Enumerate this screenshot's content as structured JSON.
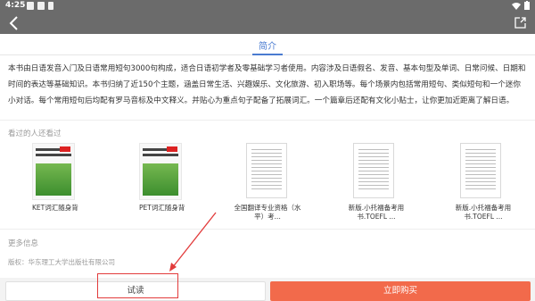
{
  "status": {
    "time": "4:25"
  },
  "tab": {
    "label": "简介"
  },
  "intro": {
    "text": "本书由日语发音入门及日语常用短句3000句构成，适合日语初学者及零基础学习者使用。内容涉及日语假名、发音、基本句型及单词、日常问候、日期和时间的表达等基础知识。本书归纳了近150个主题，涵盖日常生活、兴趣娱乐、文化旅游、初入职场等。每个场景内包括常用短句、类似短句和一个迷你小对话。每个常用短句后均配有罗马音标及中文释义。并贴心为重点句子配备了拓展词汇。一个篇章后还配有文化小贴士，让你更加近距离了解日语。"
  },
  "seen_section": {
    "title": "看过的人还看过"
  },
  "books": [
    {
      "title": "KET词汇随身背"
    },
    {
      "title": "PET词汇随身背"
    },
    {
      "title": "全国翻译专业资格（水平）考..."
    },
    {
      "title": "新版.小托福备考用书.TOEFL ..."
    },
    {
      "title": "新版.小托福备考用书.TOEFL ..."
    }
  ],
  "more_section": {
    "title": "更多信息",
    "publisher": "版权：华东理工大学出版社有限公司"
  },
  "bottom": {
    "try_label": "试读",
    "buy_label": "立即购买"
  },
  "colors": {
    "accent": "#4a7bd0",
    "buy": "#f26a4b",
    "highlight": "#e23b3b",
    "appbar": "#6b6b6b"
  }
}
